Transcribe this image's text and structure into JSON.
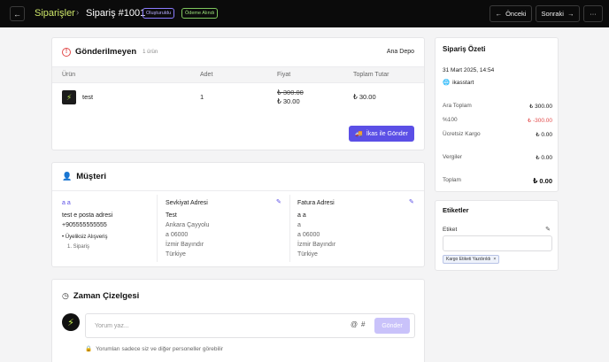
{
  "header": {
    "back_icon": "arrow-left-icon",
    "breadcrumb_root": "Siparişler",
    "title": "Sipariş #1001",
    "badge_created": "Oluşturuldu",
    "badge_paid": "Ödeme Alındı",
    "prev_label": "Önceki",
    "next_label": "Sonraki",
    "more_label": "···"
  },
  "unsent": {
    "title": "Gönderilmeyen",
    "count": "1 ürün",
    "warehouse": "Ana Depo",
    "columns": [
      "Ürün",
      "Adet",
      "Fiyat",
      "Toplam Tutar"
    ],
    "rows": [
      {
        "name": "test",
        "qty": "1",
        "price_old": "₺ 300.00",
        "price_new": "₺ 30.00",
        "total": "₺ 30.00"
      }
    ],
    "send_button": "İkas ile Gönder"
  },
  "customer": {
    "title": "Müşteri",
    "name": "a a",
    "email": "test e posta adresi",
    "phone": "+905555555555",
    "membership_label": "• Üyeliksiz Alışveriş",
    "order_count": "1. Sipariş",
    "shipping": {
      "title": "Sevkiyat Adresi",
      "lines": [
        "Test",
        "Ankara Çayyolu",
        "a 06000",
        "İzmir Bayındır",
        "Türkiye"
      ]
    },
    "billing": {
      "title": "Fatura Adresi",
      "lines": [
        "a a",
        "a",
        "a 06000",
        "İzmir Bayındır",
        "Türkiye"
      ]
    }
  },
  "timeline": {
    "title": "Zaman Çizelgesi",
    "comment_placeholder": "Yorum yaz...",
    "at_symbol": "@",
    "hash_symbol": "#",
    "send_label": "Gönder",
    "privacy_note": "Yorumları sadece siz ve diğer personeller görebilir"
  },
  "summary": {
    "title": "Sipariş Özeti",
    "date": "31 Mart 2025, 14:54",
    "channel": "ikasstart",
    "rows": [
      {
        "label": "Ara Toplam",
        "value": "₺ 300.00"
      },
      {
        "label": "%100",
        "value": "₺ -300.00"
      },
      {
        "label": "Ücretsiz Kargo",
        "value": "₺ 0.00"
      },
      {
        "label": "Vergiler",
        "value": "₺ 0.00"
      }
    ],
    "total_label": "Toplam",
    "total_value": "₺ 0.00"
  },
  "tags": {
    "title": "Etiketler",
    "label": "Etiket",
    "chip": "Kargo Etiketi Yazdırıldı",
    "chip_remove": "×"
  },
  "colors": {
    "accent": "#5b4fe6",
    "brand_green": "#cfe86a",
    "danger": "#e24b4b"
  }
}
